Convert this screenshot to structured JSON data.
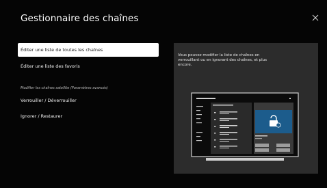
{
  "header": {
    "title": "Gestionnaire des chaînes",
    "close_icon": "close-icon"
  },
  "menu": {
    "items": [
      {
        "label": "Éditer une liste de toutes les chaînes",
        "selected": true
      },
      {
        "label": "Éditer une liste des favoris",
        "selected": false
      }
    ],
    "section_caption": "Modifier les chaînes satellite (Paramètres avancés)",
    "sub_items": [
      {
        "label": "Verrouiller / Déverrouiller"
      },
      {
        "label": "Ignorer / Restaurer"
      }
    ]
  },
  "info_panel": {
    "description": "Vous pouvez modifier la liste de chaînes en verrouillant ou en ignorant des chaînes, et plus encore.",
    "illustration_icon": "tv-lock-illustration"
  },
  "colors": {
    "background": "#050505",
    "panel": "#2c2c2c",
    "selected": "#ffffff",
    "accent": "#1c5c8c"
  }
}
